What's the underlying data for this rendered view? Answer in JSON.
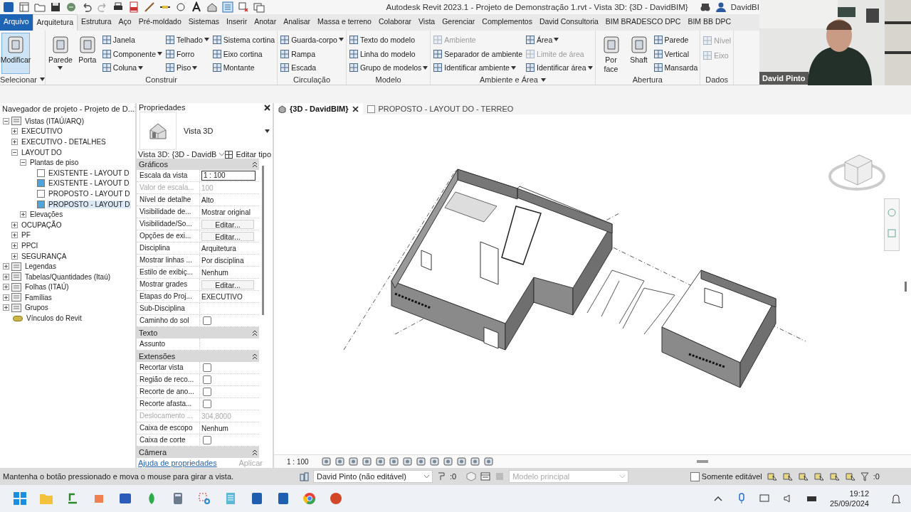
{
  "title_bar": {
    "title": "Autodesk Revit 2023.1 - Projeto de Demonstração 1.rvt - Vista 3D: {3D - DavidBIM}",
    "user": "DavidBI"
  },
  "ribbon_tabs": [
    {
      "label": "Arquivo",
      "kind": "file",
      "selected": false
    },
    {
      "label": "Arquitetura",
      "kind": "tab",
      "selected": true
    },
    {
      "label": "Estrutura",
      "kind": "tab",
      "selected": false
    },
    {
      "label": "Aço",
      "kind": "tab",
      "selected": false
    },
    {
      "label": "Pré-moldado",
      "kind": "tab",
      "selected": false
    },
    {
      "label": "Sistemas",
      "kind": "tab",
      "selected": false
    },
    {
      "label": "Inserir",
      "kind": "tab",
      "selected": false
    },
    {
      "label": "Anotar",
      "kind": "tab",
      "selected": false
    },
    {
      "label": "Analisar",
      "kind": "tab",
      "selected": false
    },
    {
      "label": "Massa e terreno",
      "kind": "tab",
      "selected": false
    },
    {
      "label": "Colaborar",
      "kind": "tab",
      "selected": false
    },
    {
      "label": "Vista",
      "kind": "tab",
      "selected": false
    },
    {
      "label": "Gerenciar",
      "kind": "tab",
      "selected": false
    },
    {
      "label": "Complementos",
      "kind": "tab",
      "selected": false
    },
    {
      "label": "David Consultoria",
      "kind": "tab",
      "selected": false
    },
    {
      "label": "BIM BRADESCO DPC",
      "kind": "tab",
      "selected": false
    },
    {
      "label": "BIM BB DPC",
      "kind": "tab",
      "selected": false
    }
  ],
  "ribbon_panels": [
    {
      "title": "Selecionar",
      "menu": true,
      "columns": [
        {
          "kind": "large",
          "items": [
            {
              "label": "Modificar",
              "active": true,
              "dropdown": false
            }
          ]
        }
      ]
    },
    {
      "title": "Construir",
      "menu": false,
      "columns": [
        {
          "kind": "large",
          "items": [
            {
              "label": "Parede",
              "active": false,
              "dropdown": true
            }
          ]
        },
        {
          "kind": "large",
          "items": [
            {
              "label": "Porta",
              "active": false,
              "dropdown": false
            }
          ]
        },
        {
          "kind": "small",
          "items": [
            {
              "label": "Janela",
              "dropdown": false,
              "disabled": false
            },
            {
              "label": "Componente",
              "dropdown": true,
              "disabled": false
            },
            {
              "label": "Coluna",
              "dropdown": true,
              "disabled": false
            }
          ]
        },
        {
          "kind": "small",
          "items": [
            {
              "label": "Telhado",
              "dropdown": true,
              "disabled": false
            },
            {
              "label": "Forro",
              "dropdown": false,
              "disabled": false
            },
            {
              "label": "Piso",
              "dropdown": true,
              "disabled": false
            }
          ]
        },
        {
          "kind": "small",
          "items": [
            {
              "label": "Sistema cortina",
              "dropdown": false,
              "disabled": false
            },
            {
              "label": "Eixo cortina",
              "dropdown": false,
              "disabled": false
            },
            {
              "label": "Montante",
              "dropdown": false,
              "disabled": false
            }
          ]
        }
      ]
    },
    {
      "title": "Circulação",
      "menu": false,
      "columns": [
        {
          "kind": "small",
          "items": [
            {
              "label": "Guarda-corpo",
              "dropdown": true,
              "disabled": false
            },
            {
              "label": "Rampa",
              "dropdown": false,
              "disabled": false
            },
            {
              "label": "Escada",
              "dropdown": false,
              "disabled": false
            }
          ]
        }
      ]
    },
    {
      "title": "Modelo",
      "menu": false,
      "columns": [
        {
          "kind": "small",
          "items": [
            {
              "label": "Texto do modelo",
              "dropdown": false,
              "disabled": false
            },
            {
              "label": "Linha do modelo",
              "dropdown": false,
              "disabled": false
            },
            {
              "label": "Grupo de modelos",
              "dropdown": true,
              "disabled": false
            }
          ]
        }
      ]
    },
    {
      "title": "Ambiente e Área",
      "menu": true,
      "columns": [
        {
          "kind": "small",
          "items": [
            {
              "label": "Ambiente",
              "dropdown": false,
              "disabled": true
            },
            {
              "label": "Separador de ambiente",
              "dropdown": false,
              "disabled": false
            },
            {
              "label": "Identificar ambiente",
              "dropdown": true,
              "disabled": false
            }
          ]
        },
        {
          "kind": "small",
          "items": [
            {
              "label": "Área",
              "dropdown": true,
              "disabled": false
            },
            {
              "label": "Limite de área",
              "dropdown": false,
              "disabled": true
            },
            {
              "label": "Identificar área",
              "dropdown": true,
              "disabled": false
            }
          ]
        }
      ]
    },
    {
      "title": "Abertura",
      "menu": false,
      "columns": [
        {
          "kind": "large",
          "items": [
            {
              "label": "Por face",
              "active": false,
              "dropdown": false
            }
          ]
        },
        {
          "kind": "large",
          "items": [
            {
              "label": "Shaft",
              "active": false,
              "dropdown": false
            }
          ]
        },
        {
          "kind": "small",
          "items": [
            {
              "label": "Parede",
              "dropdown": false,
              "disabled": false
            },
            {
              "label": "Vertical",
              "dropdown": false,
              "disabled": false
            },
            {
              "label": "Mansarda",
              "dropdown": false,
              "disabled": false
            }
          ]
        }
      ]
    },
    {
      "title": "Dados",
      "menu": false,
      "columns": [
        {
          "kind": "small",
          "items": [
            {
              "label": "Nível",
              "dropdown": false,
              "disabled": true
            },
            {
              "label": "Eixo",
              "dropdown": false,
              "disabled": true
            }
          ]
        }
      ]
    }
  ],
  "project_browser": {
    "title": "Navegador de projeto - Projeto de D...",
    "tree": [
      {
        "label": "Vistas (ITAÚ/ARQ)",
        "kind": "folder",
        "expanded": true,
        "children": [
          {
            "label": "EXECUTIVO",
            "kind": "folder",
            "expanded": false
          },
          {
            "label": "EXECUTIVO - DETALHES",
            "kind": "folder",
            "expanded": false
          },
          {
            "label": "LAYOUT DO",
            "kind": "folder",
            "expanded": true,
            "children": [
              {
                "label": "Plantas de piso",
                "kind": "folder",
                "expanded": true,
                "children": [
                  {
                    "label": "EXISTENTE - LAYOUT D",
                    "kind": "view",
                    "open": false,
                    "selected": false
                  },
                  {
                    "label": "EXISTENTE - LAYOUT D",
                    "kind": "view",
                    "open": true,
                    "selected": false
                  },
                  {
                    "label": "PROPOSTO - LAYOUT D",
                    "kind": "view",
                    "open": false,
                    "selected": false
                  },
                  {
                    "label": "PROPOSTO - LAYOUT D",
                    "kind": "view",
                    "open": true,
                    "selected": true
                  }
                ]
              },
              {
                "label": "Elevações",
                "kind": "folder",
                "expanded": false
              }
            ]
          },
          {
            "label": "OCUPAÇÃO",
            "kind": "folder",
            "expanded": false
          },
          {
            "label": "PF",
            "kind": "folder",
            "expanded": false
          },
          {
            "label": "PPCI",
            "kind": "folder",
            "expanded": false
          },
          {
            "label": "SEGURANÇA",
            "kind": "folder",
            "expanded": false
          }
        ]
      },
      {
        "label": "Legendas",
        "kind": "folder",
        "expanded": false
      },
      {
        "label": "Tabelas/Quantidades (Itaú)",
        "kind": "folder",
        "expanded": false
      },
      {
        "label": "Folhas (ITAÚ)",
        "kind": "folder",
        "expanded": false
      },
      {
        "label": "Famílias",
        "kind": "folder",
        "expanded": false
      },
      {
        "label": "Grupos",
        "kind": "folder",
        "expanded": false
      },
      {
        "label": "Vínculos do Revit",
        "kind": "link"
      }
    ]
  },
  "properties": {
    "title": "Propriedades",
    "type_name": "Vista 3D",
    "instance": "Vista 3D: {3D - DavidB",
    "edit_type": "Editar tipo",
    "groups": [
      {
        "title": "Gráficos",
        "rows": [
          {
            "label": "Escala da vista",
            "kind": "input",
            "value": "1 : 100",
            "disabled": false
          },
          {
            "label": "Valor de escala...",
            "kind": "text",
            "value": "100",
            "disabled": true
          },
          {
            "label": "Nível de detalhe",
            "kind": "text",
            "value": "Alto",
            "disabled": false
          },
          {
            "label": "Visibilidade de...",
            "kind": "text",
            "value": "Mostrar original",
            "disabled": false
          },
          {
            "label": "Visibilidade/So...",
            "kind": "button",
            "value": "Editar...",
            "disabled": false
          },
          {
            "label": "Opções de exi...",
            "kind": "button",
            "value": "Editar...",
            "disabled": false
          },
          {
            "label": "Disciplina",
            "kind": "text",
            "value": "Arquitetura",
            "disabled": false
          },
          {
            "label": "Mostrar linhas ...",
            "kind": "text",
            "value": "Por disciplina",
            "disabled": false
          },
          {
            "label": "Estilo de exibiç...",
            "kind": "text",
            "value": "Nenhum",
            "disabled": false
          },
          {
            "label": "Mostrar grades",
            "kind": "button",
            "value": "Editar...",
            "disabled": false
          },
          {
            "label": "Etapas do Proj...",
            "kind": "text",
            "value": "EXECUTIVO",
            "disabled": false
          },
          {
            "label": "Sub-Disciplina",
            "kind": "text",
            "disabled": false
          },
          {
            "label": "Caminho do sol",
            "kind": "checkbox",
            "checked": false,
            "disabled": false
          }
        ]
      },
      {
        "title": "Texto",
        "rows": [
          {
            "label": "Assunto",
            "kind": "text",
            "disabled": false
          }
        ]
      },
      {
        "title": "Extensões",
        "rows": [
          {
            "label": "Recortar vista",
            "kind": "checkbox",
            "checked": false,
            "disabled": false
          },
          {
            "label": "Região de reco...",
            "kind": "checkbox",
            "checked": false,
            "disabled": false
          },
          {
            "label": "Recorte de ano...",
            "kind": "checkbox",
            "checked": false,
            "disabled": false
          },
          {
            "label": "Recorte afasta...",
            "kind": "checkbox",
            "checked": false,
            "disabled": false
          },
          {
            "label": "Deslocamento ...",
            "kind": "text",
            "value": "304,8000",
            "disabled": true
          },
          {
            "label": "Caixa de escopo",
            "kind": "text",
            "value": "Nenhum",
            "disabled": false
          },
          {
            "label": "Caixa de corte",
            "kind": "checkbox",
            "checked": false,
            "disabled": false
          }
        ]
      },
      {
        "title": "Câmera"
      }
    ],
    "help_link": "Ajuda de propriedades",
    "apply": {
      "label": "Aplicar",
      "disabled": true
    }
  },
  "view_tabs": [
    {
      "label": "{3D - DavidBIM}",
      "selected": true,
      "closable": true
    },
    {
      "label": "PROPOSTO - LAYOUT DO - TERREO",
      "selected": false,
      "closable": false
    }
  ],
  "view_bar": {
    "scale": "1 : 100"
  },
  "status_bar": {
    "message": "Mantenha o botão pressionado e mova o mouse para girar a vista.",
    "workset": "David Pinto (não editável)",
    "editable_count": ":0",
    "design_option": "Modelo principal",
    "only_editable": {
      "label": "Somente editável",
      "checked": false
    },
    "filter_count": ":0"
  },
  "taskbar": {
    "time": "19:12",
    "date": "25/09/2024"
  },
  "webcam": {
    "name": "David Pinto"
  }
}
